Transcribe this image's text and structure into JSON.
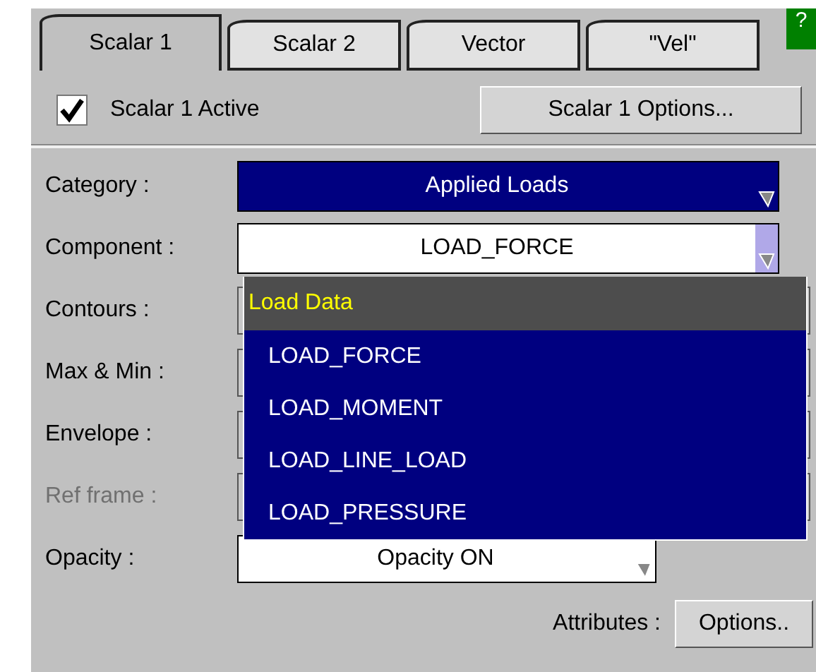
{
  "tabs": [
    {
      "label": "Scalar 1",
      "selected": true
    },
    {
      "label": "Scalar 2",
      "selected": false
    },
    {
      "label": "Vector",
      "selected": false
    },
    {
      "label": "\"Vel\"",
      "selected": false
    }
  ],
  "help_button": "?",
  "active_checkbox": {
    "label": "Scalar 1 Active",
    "checked": true
  },
  "options_button": "Scalar 1 Options...",
  "rows": [
    {
      "label": "Category :",
      "kind": "highlighted",
      "value": "Applied Loads",
      "disabled": false
    },
    {
      "label": "Component :",
      "kind": "open",
      "value": "LOAD_FORCE",
      "disabled": false
    },
    {
      "label": "Contours :",
      "kind": "hidden",
      "disabled": false
    },
    {
      "label": "Max & Min :",
      "kind": "hidden",
      "disabled": false
    },
    {
      "label": "Envelope :",
      "kind": "hidden",
      "disabled": false
    },
    {
      "label": "Ref frame :",
      "kind": "hidden",
      "disabled": true
    },
    {
      "label": "Opacity :",
      "kind": "short",
      "value": "Opacity ON",
      "disabled": false
    }
  ],
  "popup": {
    "header": "Load Data",
    "items": [
      "LOAD_FORCE",
      "LOAD_MOMENT",
      "LOAD_LINE_LOAD",
      "LOAD_PRESSURE"
    ]
  },
  "attributes": {
    "label": "Attributes :",
    "button": "Options.."
  }
}
